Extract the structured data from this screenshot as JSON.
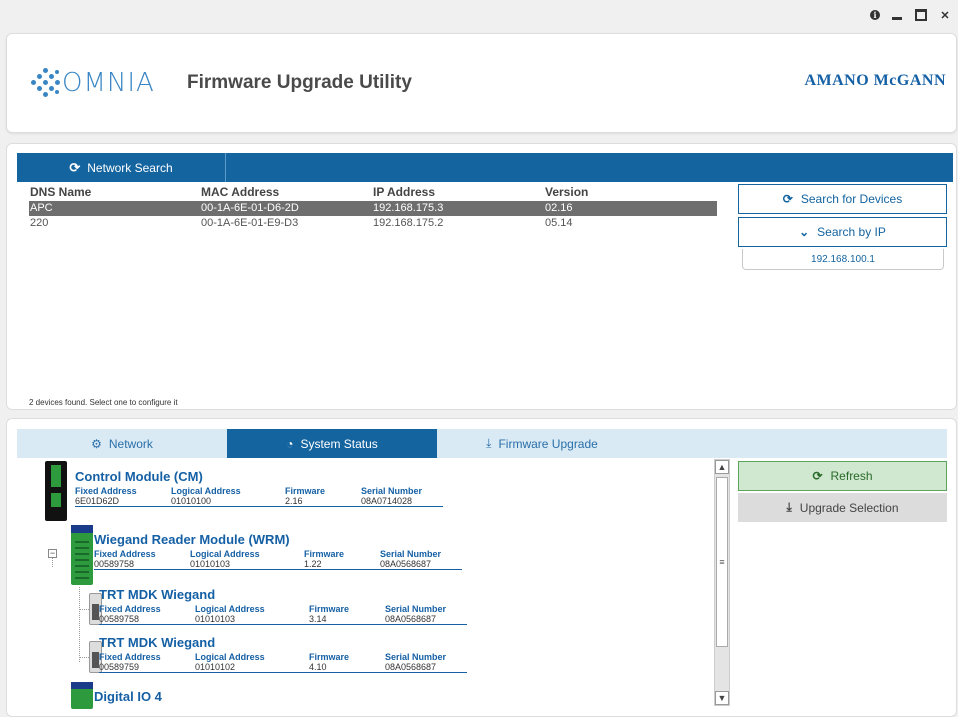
{
  "window": {
    "controls": {
      "info_icon": "info-icon",
      "minimize_icon": "minimize-icon",
      "maximize_icon": "maximize-icon",
      "close_icon": "close-icon"
    }
  },
  "header": {
    "logo_text": "OMNIA",
    "title": "Firmware Upgrade Utility",
    "brand": "AMANO McGANN"
  },
  "network_search": {
    "tab_label": "Network Search",
    "columns": [
      "DNS Name",
      "MAC Address",
      "IP Address",
      "Version"
    ],
    "rows": [
      [
        "APC",
        "00-1A-6E-01-D6-2D",
        "192.168.175.3",
        "02.16"
      ],
      [
        "220",
        "00-1A-6E-01-E9-D3",
        "192.168.175.2",
        "05.14"
      ]
    ],
    "search_devices_label": "Search for Devices",
    "search_ip_label": "Search by IP",
    "ip_value": "192.168.100.1",
    "status": "2 devices found. Select one to configure it"
  },
  "tabs": [
    {
      "label": "Network",
      "icon": "gear-icon"
    },
    {
      "label": "System Status",
      "icon": "dashboard-icon"
    },
    {
      "label": "Firmware Upgrade",
      "icon": "download-icon"
    }
  ],
  "field_labels": {
    "fixed": "Fixed Address",
    "logical": "Logical Address",
    "firmware": "Firmware",
    "serial": "Serial Number"
  },
  "modules": [
    {
      "name": "Control Module (CM)",
      "fixed": "6E01D62D",
      "logical": "01010100",
      "firmware": "2.16",
      "serial": "08A0714028"
    },
    {
      "name": "Wiegand Reader Module (WRM)",
      "fixed": "00589758",
      "logical": "01010103",
      "firmware": "1.22",
      "serial": "08A0568687"
    },
    {
      "name": "TRT MDK Wiegand",
      "fixed": "00589758",
      "logical": "01010103",
      "firmware": "3.14",
      "serial": "08A0568687"
    },
    {
      "name": "TRT MDK Wiegand",
      "fixed": "00589759",
      "logical": "01010102",
      "firmware": "4.10",
      "serial": "08A0568687"
    },
    {
      "name": "Digital IO 4"
    }
  ],
  "actions": {
    "refresh_label": "Refresh",
    "upgrade_label": "Upgrade Selection"
  },
  "colors": {
    "primary": "#1464a0",
    "brand": "#1560a5",
    "refresh_bg": "#cfe8cf",
    "selected_row": "#6e6e6e"
  }
}
